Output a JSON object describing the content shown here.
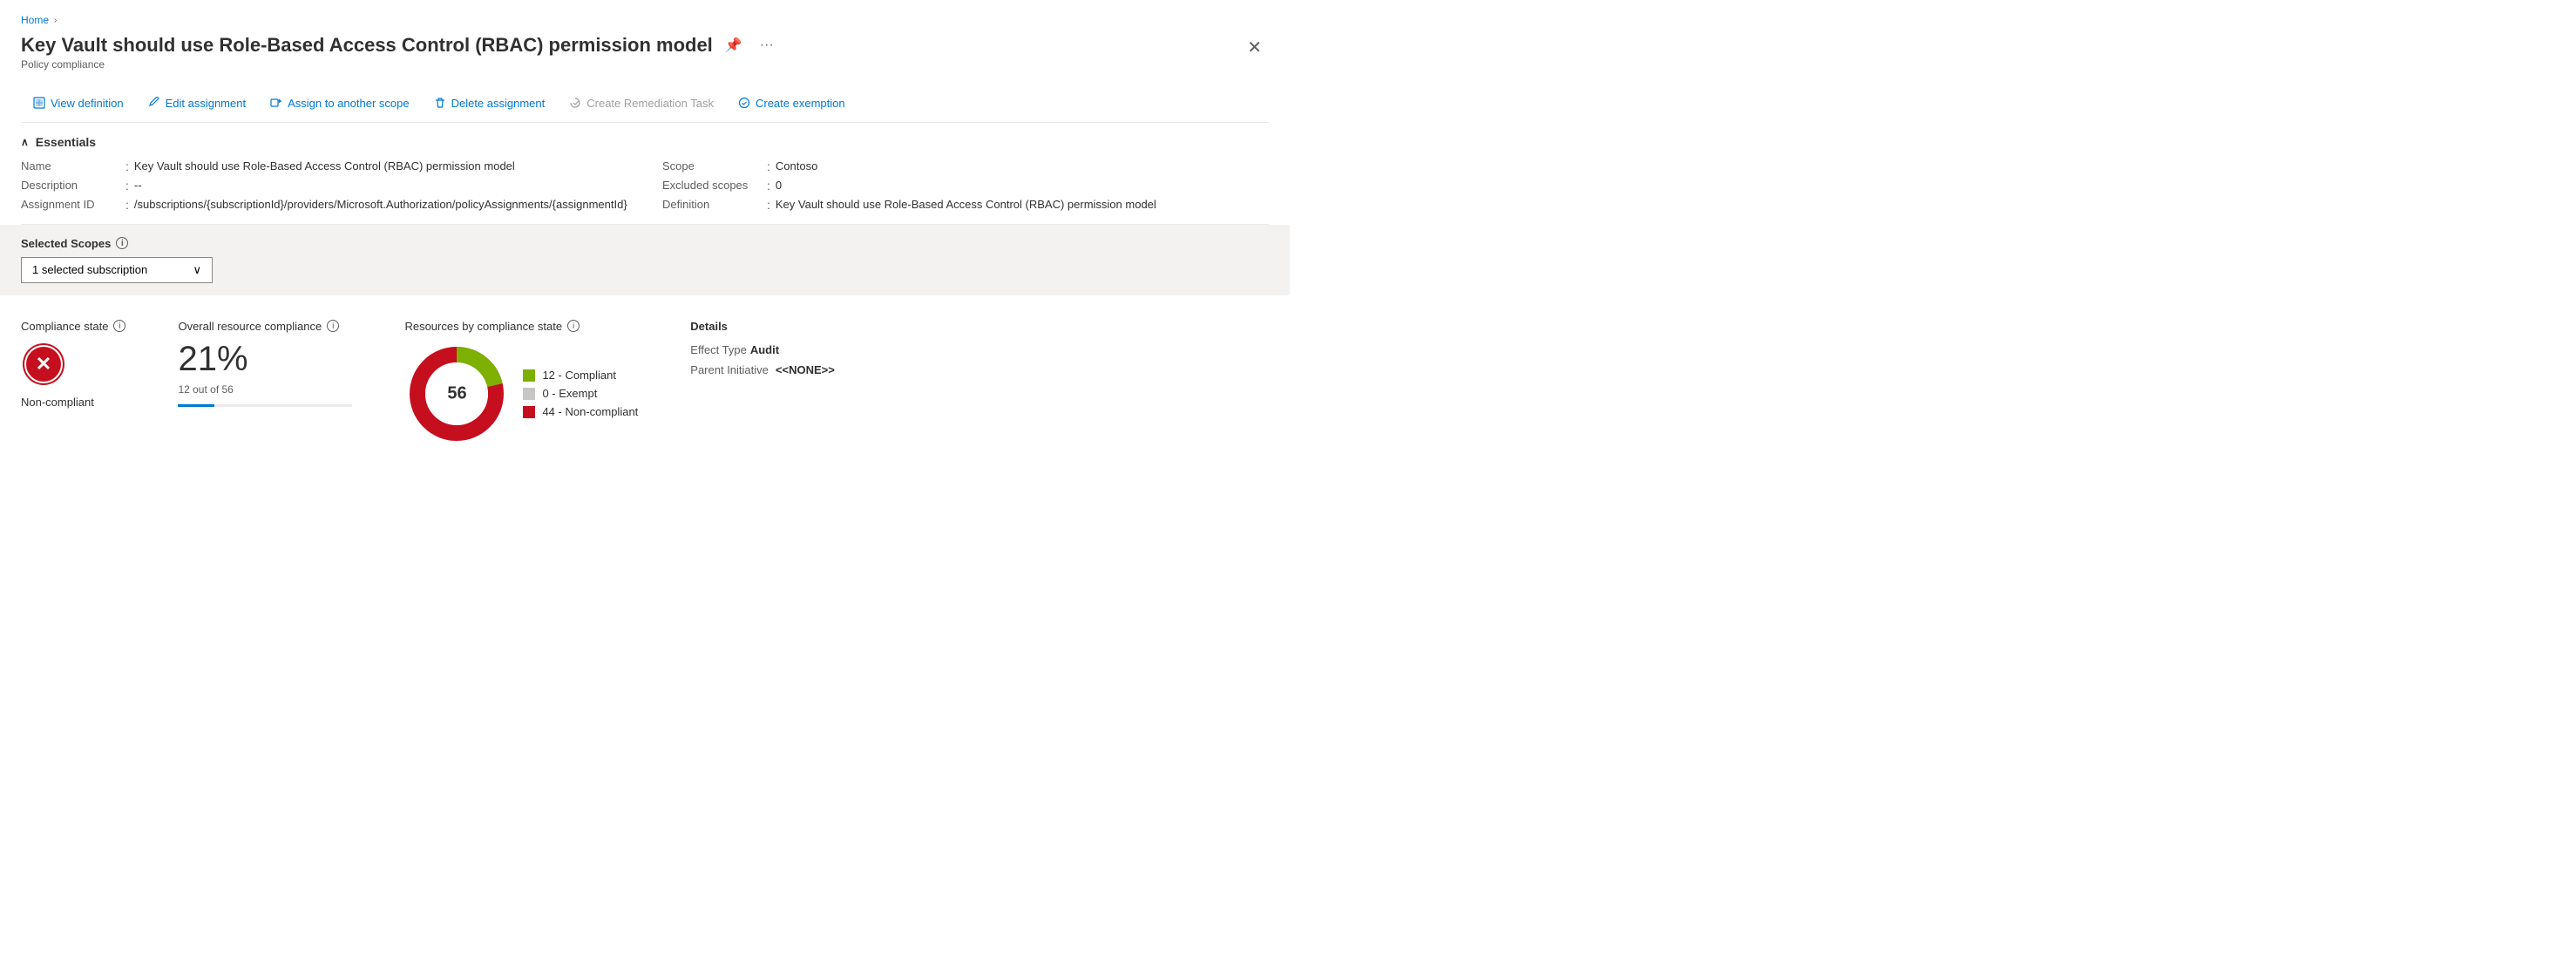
{
  "breadcrumb": {
    "home_label": "Home",
    "sep": "›"
  },
  "page": {
    "title": "Key Vault should use Role-Based Access Control (RBAC) permission model",
    "subtitle": "Policy compliance"
  },
  "toolbar": {
    "view_definition": "View definition",
    "edit_assignment": "Edit assignment",
    "assign_to_another_scope": "Assign to another scope",
    "delete_assignment": "Delete assignment",
    "create_remediation_task": "Create Remediation Task",
    "create_exemption": "Create exemption"
  },
  "essentials": {
    "header": "Essentials",
    "fields": {
      "name_label": "Name",
      "name_value": "Key Vault should use Role-Based Access Control (RBAC) permission model",
      "description_label": "Description",
      "description_value": "--",
      "assignment_id_label": "Assignment ID",
      "assignment_id_value": "/subscriptions/{subscriptionId}/providers/Microsoft.Authorization/policyAssignments/{assignmentId}",
      "scope_label": "Scope",
      "scope_value": "Contoso",
      "excluded_scopes_label": "Excluded scopes",
      "excluded_scopes_value": "0",
      "definition_label": "Definition",
      "definition_value": "Key Vault should use Role-Based Access Control (RBAC) permission model"
    }
  },
  "scopes": {
    "label": "Selected Scopes",
    "dropdown_value": "1 selected subscription"
  },
  "compliance": {
    "state_title": "Compliance state",
    "state_value": "Non-compliant",
    "overall_title": "Overall resource compliance",
    "overall_pct": "21%",
    "overall_sub": "12 out of 56",
    "resources_title": "Resources by compliance state",
    "total": 56,
    "compliant": 12,
    "exempt": 0,
    "non_compliant": 44,
    "legend": [
      {
        "label": "12 - Compliant",
        "color": "#7db000"
      },
      {
        "label": "0 - Exempt",
        "color": "#c8c6c4"
      },
      {
        "label": "44 - Non-compliant",
        "color": "#c50f1f"
      }
    ]
  },
  "details": {
    "title": "Details",
    "effect_type_label": "Effect Type",
    "effect_type_value": "Audit",
    "parent_initiative_label": "Parent Initiative",
    "parent_initiative_value": "<<NONE>>"
  },
  "icons": {
    "pin": "📌",
    "ellipsis": "···",
    "close": "✕",
    "chevron_down": "∨",
    "chevron_left": "‹"
  }
}
